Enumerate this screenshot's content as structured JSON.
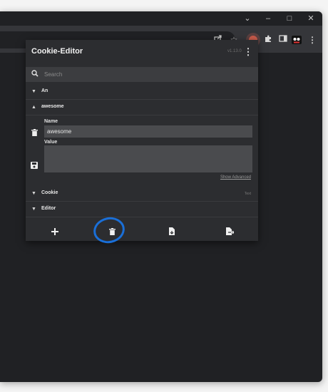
{
  "window_controls": {
    "chevron": "⌄",
    "minimize": "–",
    "maximize": "□",
    "close": "✕"
  },
  "toolbar": {
    "icons": [
      "share-icon",
      "star-icon",
      "cookie-editor-extension-icon",
      "puzzle-icon",
      "sidepanel-icon",
      "profile-avatar-icon",
      "kebab-menu-icon"
    ]
  },
  "popup": {
    "title": "Cookie-Editor",
    "version": "v1.13.0",
    "search": {
      "placeholder": "Search"
    },
    "cookies": [
      {
        "name": "An",
        "expanded": false,
        "meta": ""
      },
      {
        "name": "awesome",
        "expanded": true,
        "meta": ""
      },
      {
        "name": "Cookie",
        "expanded": false,
        "meta": "Text"
      },
      {
        "name": "Editor",
        "expanded": false,
        "meta": ""
      }
    ],
    "edit": {
      "name_label": "Name",
      "name_value": "awesome",
      "value_label": "Value",
      "value_value": "",
      "show_advanced": "Show Advanced"
    },
    "actions": [
      "add-cookie",
      "delete-all",
      "import",
      "export"
    ]
  },
  "colors": {
    "popup_bg": "#2c2d30",
    "annotation_circle": "#1a6fd8"
  }
}
